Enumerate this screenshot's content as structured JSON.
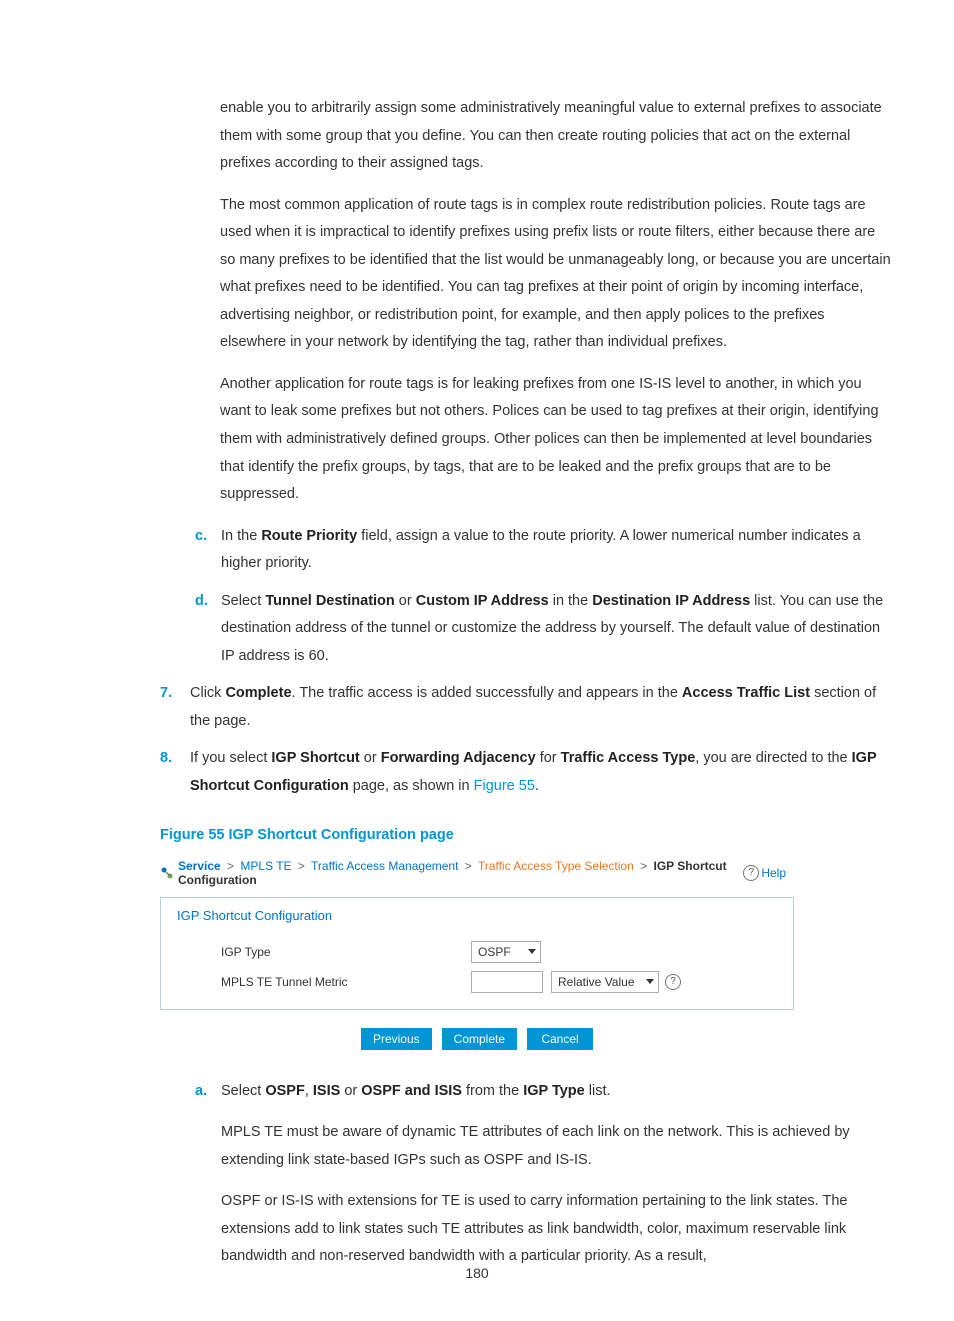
{
  "page_number": "180",
  "intro": {
    "p1": "enable you to arbitrarily assign some administratively meaningful value to external prefixes to associate them with some group that you define. You can then create routing policies that act on the external prefixes according to their assigned tags.",
    "p2": "The most common application of route tags is in complex route redistribution policies. Route tags are used when it is impractical to identify prefixes using prefix lists or route filters, either because there are so many prefixes to be identified that the list would be unmanageably long, or because you are uncertain what prefixes need to be identified. You can tag prefixes at their point of origin by incoming interface, advertising neighbor, or redistribution point, for example, and then apply polices to the prefixes elsewhere in your network by identifying the tag, rather than individual prefixes.",
    "p3": "Another application for route tags is for leaking prefixes from one IS-IS level to another, in which you want to leak some prefixes but not others. Polices can be used to tag prefixes at their origin, identifying them with administratively defined groups. Other polices can then be implemented at level boundaries that identify the prefix groups, by tags, that are to be leaked and the prefix groups that are to be suppressed."
  },
  "step_c": {
    "marker": "c.",
    "pre": "In the ",
    "bold1": "Route Priority",
    "post": " field, assign a value to the route priority. A lower numerical number indicates a higher priority."
  },
  "step_d": {
    "marker": "d.",
    "t1": "Select ",
    "b1": "Tunnel Destination",
    "t2": " or ",
    "b2": "Custom IP Address",
    "t3": " in the ",
    "b3": "Destination IP Address",
    "t4": " list. You can use the destination address of the tunnel or customize the address by yourself. The default value of destination IP address is 60."
  },
  "step7": {
    "marker": "7.",
    "t1": "Click ",
    "b1": "Complete",
    "t2": ". The traffic access is added successfully and appears in the ",
    "b2": "Access Traffic List",
    "t3": " section of the page."
  },
  "step8": {
    "marker": "8.",
    "t1": "If you select ",
    "b1": "IGP Shortcut",
    "t2": " or ",
    "b2": "Forwarding Adjacency",
    "t3": " for ",
    "b3": "Traffic Access Type",
    "t4": ", you are directed to the ",
    "b4": "IGP Shortcut Configuration",
    "t5": " page, as shown in ",
    "link": "Figure 55",
    "t6": "."
  },
  "figure_caption": "Figure 55 IGP Shortcut Configuration page",
  "shot": {
    "crumb": {
      "service": "Service",
      "mpls": "MPLS TE",
      "tam": "Traffic Access Management",
      "tats": "Traffic Access Type Selection",
      "igp": "IGP Shortcut Configuration"
    },
    "help": "Help",
    "panel_title": "IGP Shortcut Configuration",
    "labels": {
      "igp_type": "IGP Type",
      "metric": "MPLS TE Tunnel Metric"
    },
    "values": {
      "igp_type": "OSPF",
      "relval": "Relative Value"
    },
    "buttons": {
      "prev": "Previous",
      "complete": "Complete",
      "cancel": "Cancel"
    }
  },
  "step_a2": {
    "marker": "a.",
    "t1": "Select ",
    "b1": "OSPF",
    "t2": ", ",
    "b2": "ISIS",
    "t3": " or ",
    "b3": "OSPF and ISIS",
    "t4": " from the ",
    "b4": "IGP Type",
    "t5": " list.",
    "p2": "MPLS TE must be aware of dynamic TE attributes of each link on the network. This is achieved by extending link state-based IGPs such as OSPF and IS-IS.",
    "p3": "OSPF or IS-IS with extensions for TE is used to carry information pertaining to the link states. The extensions add to link states such TE attributes as link bandwidth, color, maximum reservable link bandwidth and non-reserved bandwidth with a particular priority. As a result,"
  }
}
